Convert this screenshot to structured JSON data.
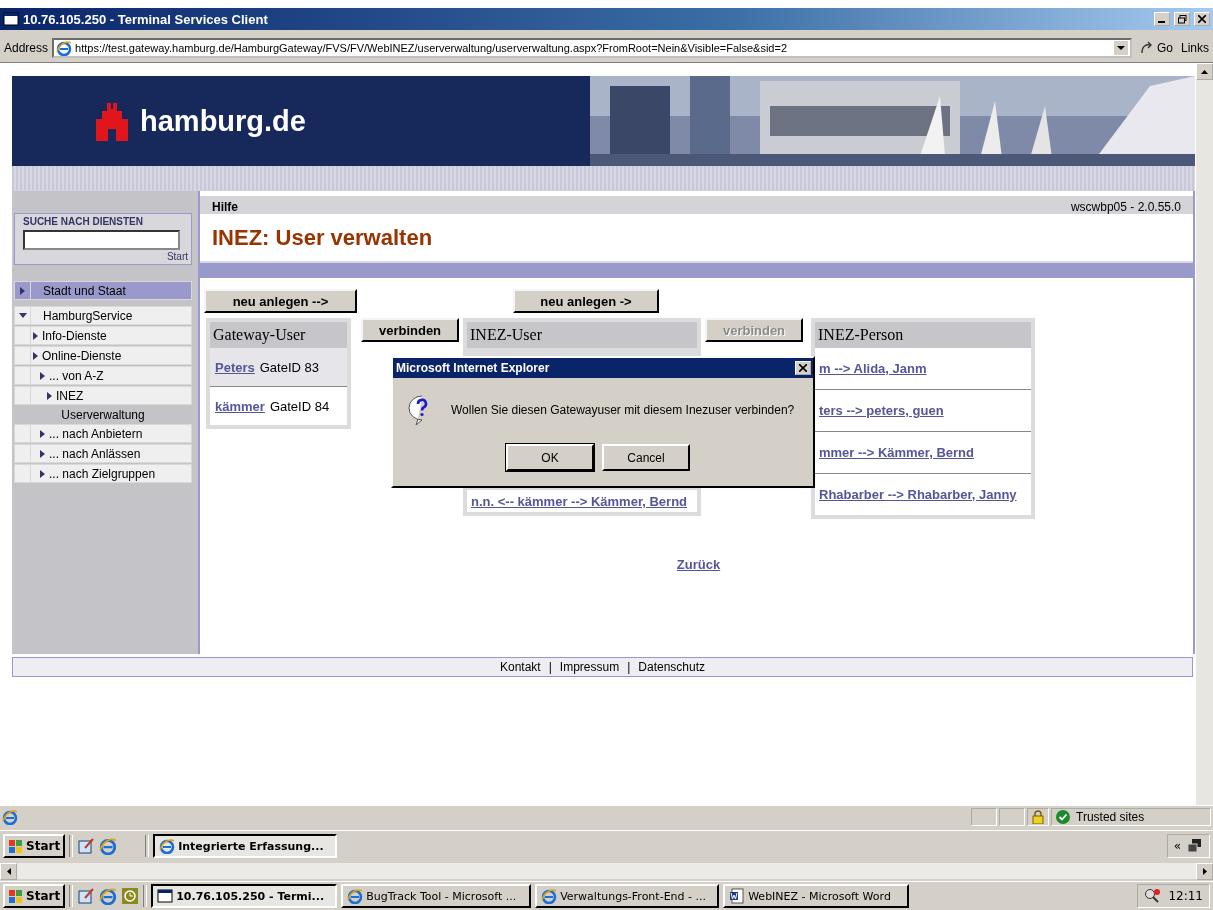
{
  "window": {
    "title": "10.76.105.250 - Terminal Services Client"
  },
  "address_bar": {
    "label": "Address",
    "url": "https://test.gateway.hamburg.de/HamburgGateway/FVS/FV/WebINEZ/userverwaltung/userverwaltung.aspx?FromRoot=Nein&Visible=False&sid=2",
    "go": "Go",
    "links": "Links"
  },
  "site": {
    "logo_text": "hamburg.de"
  },
  "sidebar": {
    "search": {
      "title": "SUCHE NACH DIENSTEN",
      "button": "Start"
    },
    "nav": [
      {
        "label": "Stadt und Staat",
        "kind": "node",
        "expanded": false,
        "selected": true
      }
    ],
    "tree": [
      {
        "label": "HamburgService",
        "kind": "node",
        "expanded": true,
        "selected": false,
        "children": [
          {
            "label": "Info-Dienste",
            "kind": "node",
            "expanded": false,
            "selected": false
          },
          {
            "label": "Online-Dienste",
            "kind": "node",
            "expanded": false,
            "selected": false,
            "children": [
              {
                "label": "... von A-Z",
                "kind": "node",
                "expanded": false,
                "selected": false,
                "children": [
                  {
                    "label": "INEZ",
                    "kind": "node",
                    "expanded": false,
                    "selected": false,
                    "children": [
                      {
                        "label": "Userverwaltung",
                        "kind": "page",
                        "selected": true
                      }
                    ]
                  }
                ]
              },
              {
                "label": "... nach Anbietern",
                "kind": "node",
                "expanded": false,
                "selected": false
              },
              {
                "label": "... nach Anlässen",
                "kind": "node",
                "expanded": false,
                "selected": false
              },
              {
                "label": "... nach Zielgruppen",
                "kind": "node",
                "expanded": false,
                "selected": false
              }
            ]
          }
        ]
      }
    ]
  },
  "page": {
    "help": "Hilfe",
    "version": "wscwbp05 - 2.0.55.0",
    "title": "INEZ: User verwalten",
    "new_buttons": [
      "neu anlegen -->",
      "neu anlegen ->"
    ],
    "connect_buttons": [
      {
        "label": "verbinden",
        "disabled": false
      },
      {
        "label": "verbinden",
        "disabled": true
      }
    ],
    "gateway_users": {
      "heading": "Gateway-User",
      "rows": [
        {
          "name": "Peters",
          "id": "GateID 83",
          "selected": true
        },
        {
          "name": "kämmer",
          "id": "GateID 84",
          "selected": false
        }
      ]
    },
    "inez_users": {
      "heading": "INEZ-User",
      "rows": [
        "n.n. <-- kämmer --> Kämmer, Bernd"
      ]
    },
    "inez_persons": {
      "heading": "INEZ-Person",
      "rows": [
        "m --> Alida, Janm",
        "ters --> peters, guen",
        "mmer --> Kämmer, Bernd",
        "Rhabarber --> Rhabarber, Janny"
      ]
    },
    "back_link": "Zurück"
  },
  "footer": {
    "links": [
      "Kontakt",
      "Impressum",
      "Datenschutz"
    ],
    "separator": "|"
  },
  "dialog": {
    "title": "Microsoft Internet Explorer",
    "message": "Wollen Sie diesen Gatewayuser mit diesem Inezuser verbinden?",
    "buttons": [
      {
        "label": "OK",
        "default": true
      },
      {
        "label": "Cancel",
        "default": false
      }
    ]
  },
  "status_bar": {
    "zone": "Trusted sites"
  },
  "inner_taskbar": {
    "start": "Start",
    "tasks": [
      {
        "label": "Integrierte Erfassung...",
        "kind": "browser",
        "selected": true
      }
    ],
    "tray": "«"
  },
  "taskbar": {
    "start": "Start",
    "tasks": [
      {
        "label": "10.76.105.250 - Termi...",
        "kind": "terminal",
        "selected": true
      },
      {
        "label": "BugTrack Tool - Microsoft ...",
        "kind": "browser",
        "selected": false
      },
      {
        "label": "Verwaltungs-Front-End - ...",
        "kind": "browser",
        "selected": false
      },
      {
        "label": "WebINEZ - Microsoft Word",
        "kind": "word",
        "selected": false
      }
    ],
    "clock": "12:11"
  }
}
